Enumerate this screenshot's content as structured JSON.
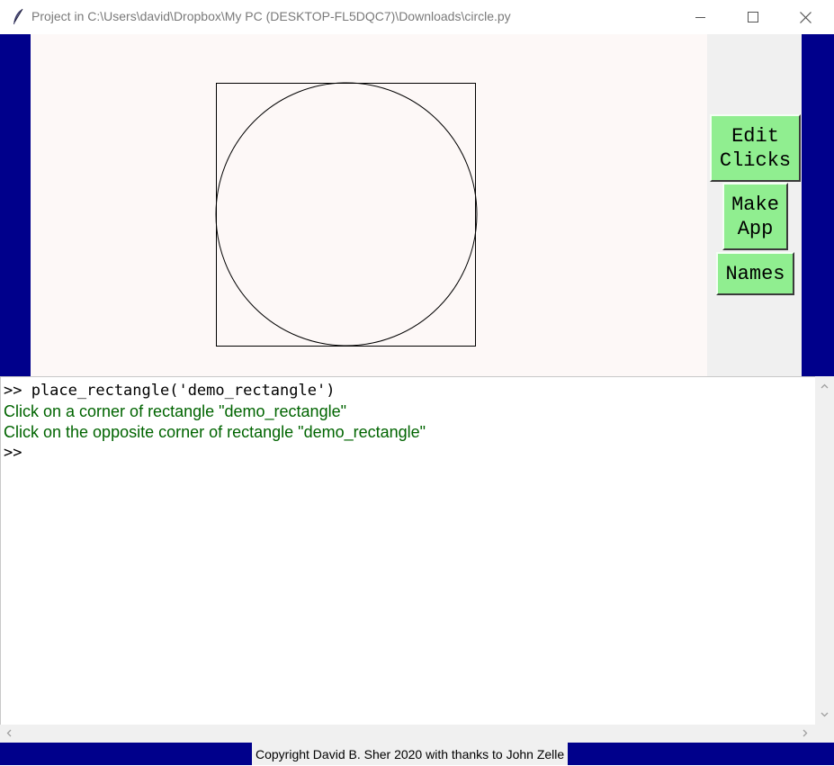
{
  "window": {
    "title": "Project in C:\\Users\\david\\Dropbox\\My PC (DESKTOP-FL5DQC7)\\Downloads\\circle.py",
    "icon": "feather-icon",
    "controls": [
      "minimize-icon",
      "maximize-icon",
      "close-icon"
    ]
  },
  "colors": {
    "frame": "#00008b",
    "canvas": "#fdf8f7",
    "button": "#90ee90",
    "console_output": "#006400"
  },
  "canvas": {
    "shapes": [
      "rectangle",
      "circle"
    ]
  },
  "buttons": {
    "edit_clicks": "Edit\nClicks",
    "make_app": "Make\nApp",
    "names": "Names"
  },
  "console": {
    "lines": [
      {
        "type": "command",
        "text": ">> place_rectangle('demo_rectangle')"
      },
      {
        "type": "output",
        "text": "Click on a corner of rectangle \"demo_rectangle\""
      },
      {
        "type": "output",
        "text": "Click on the opposite corner of rectangle \"demo_rectangle\""
      },
      {
        "type": "command",
        "text": ">>"
      }
    ]
  },
  "footer": {
    "copyright": "Copyright David B. Sher 2020 with thanks to John Zelle"
  }
}
